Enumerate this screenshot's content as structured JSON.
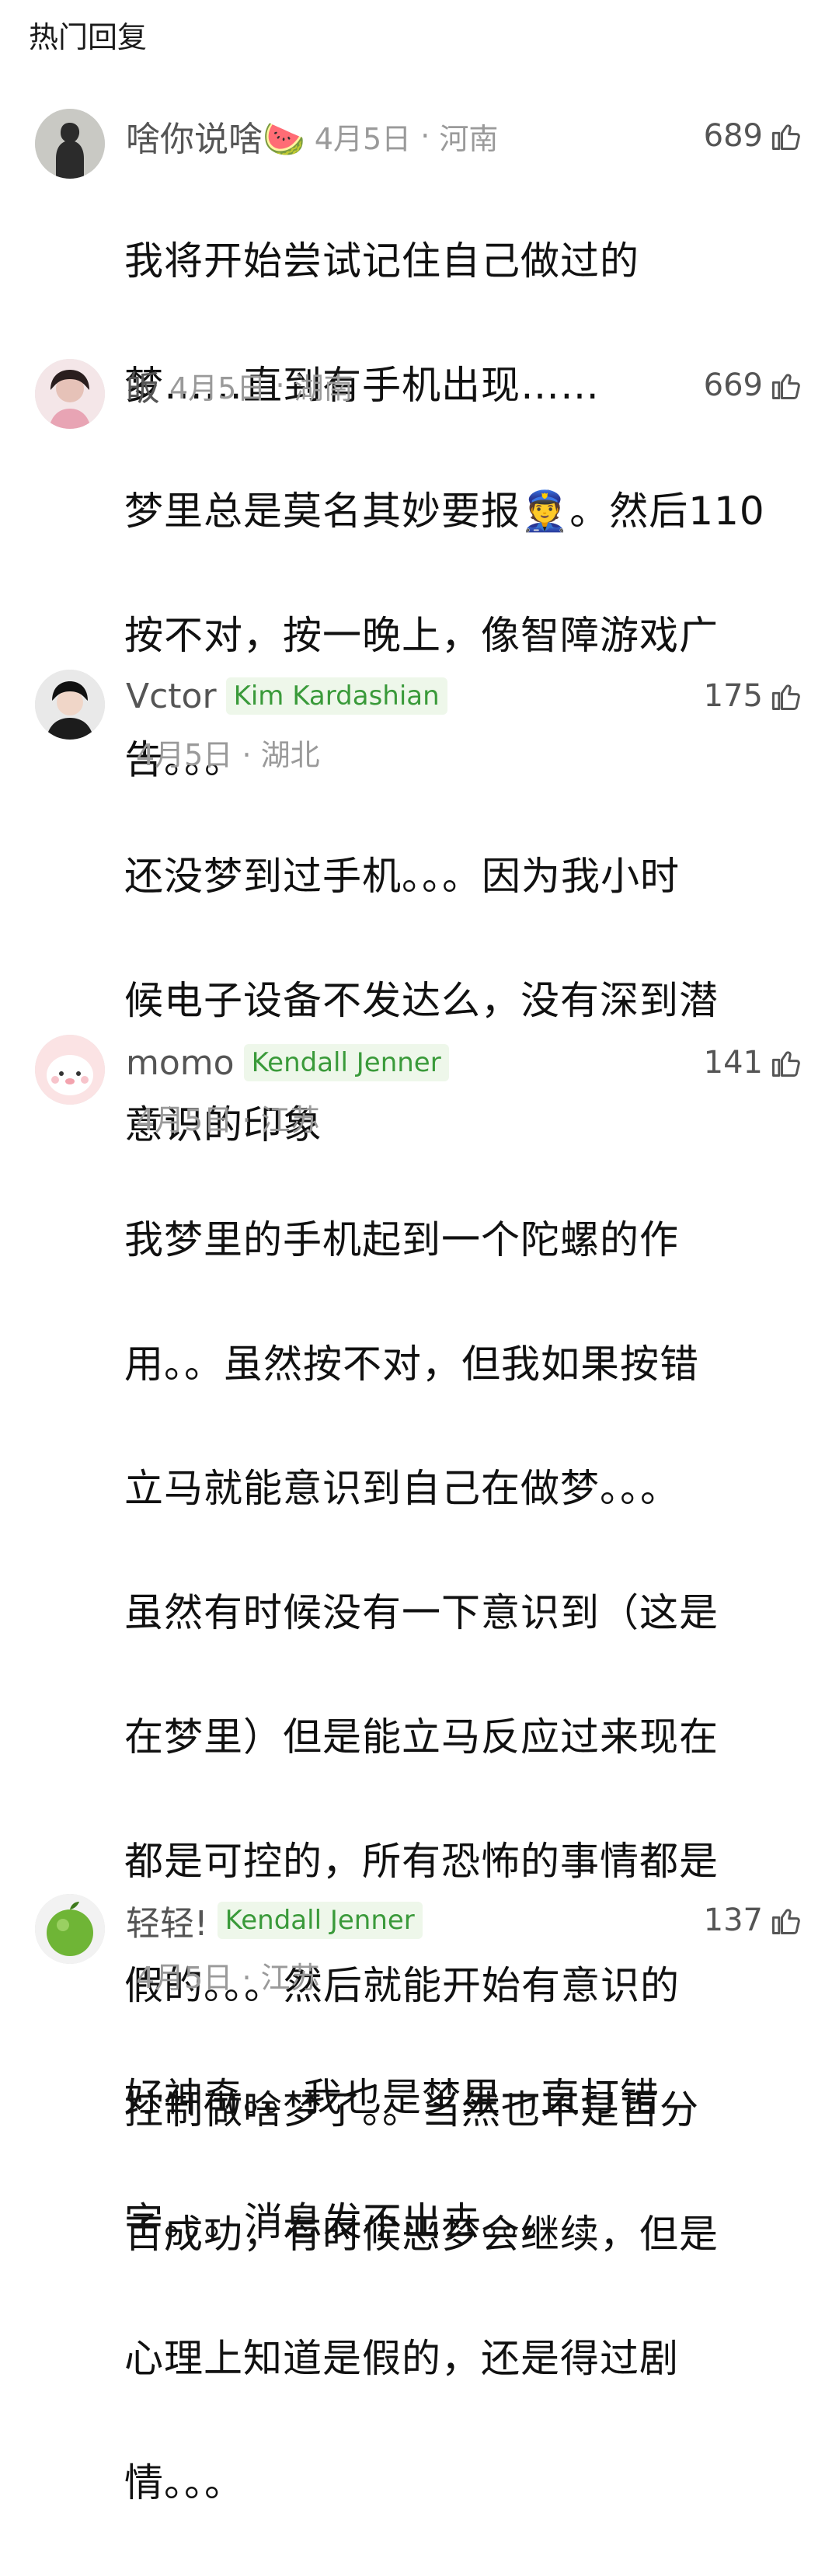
{
  "section_title": "热门回复",
  "comments": [
    {
      "username": "啥你说啥🍉",
      "badge": "",
      "date": "4月5日",
      "location": "河南",
      "likes": "689",
      "lines": [
        "我将开始尝试记住自己做过的",
        "梦……直到有手机出现……"
      ]
    },
    {
      "username": "皈",
      "badge": "",
      "date": "4月5日",
      "location": "湖南",
      "likes": "669",
      "lines": [
        "梦里总是莫名其妙要报👮。然后110",
        "按不对，按一晚上，像智障游戏广",
        "告。。。"
      ]
    },
    {
      "username": "Vctor",
      "badge": "Kim Kardashian",
      "date": "4月5日",
      "location": "湖北",
      "likes": "175",
      "lines": [
        "还没梦到过手机。。。因为我小时",
        "候电子设备不发达么，没有深到潜",
        "意识的印象"
      ]
    },
    {
      "username": "momo",
      "badge": "Kendall Jenner",
      "date": "4月5日",
      "location": "江苏",
      "likes": "141",
      "lines": [
        "我梦里的手机起到一个陀螺的作",
        "用。。虽然按不对，但我如果按错",
        "立马就能意识到自己在做梦。。。",
        "虽然有时候没有一下意识到（这是",
        "在梦里）但是能立马反应过来现在",
        "都是可控的，所有恐怖的事情都是",
        "假的。。。然后就能开始有意识的",
        "控制做啥梦了。。当然也不是百分",
        "百成功，有时候恶梦会继续，但是",
        "心理上知道是假的，还是得过剧",
        "情。。。"
      ]
    },
    {
      "username": "轻轻!",
      "badge": "Kendall Jenner",
      "date": "4月5日",
      "location": "江苏",
      "likes": "137",
      "lines": [
        "好神奇。。我也是梦里一直打错",
        "字。。。消息发不出去。。。"
      ]
    }
  ]
}
